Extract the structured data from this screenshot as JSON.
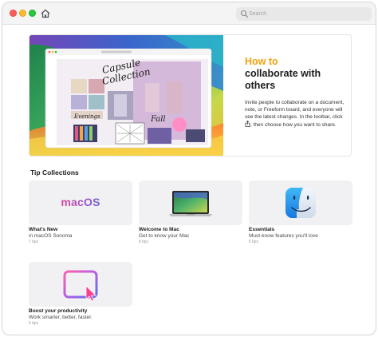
{
  "search": {
    "placeholder": "Search"
  },
  "featured": {
    "kicker": "How to",
    "title": "collaborate with others",
    "body_before_icon": "Invite people to collaborate on a document, note, or Freeform board, and everyone will see the latest changes. In the toolbar, click",
    "body_after_icon": ", then choose how you want to share.",
    "accent_color": "#f2a20f",
    "image_text": {
      "board_line1": "Capsule",
      "board_line2": "Collection",
      "word1": "Evenings",
      "word2": "Fall"
    }
  },
  "collections": {
    "title": "Tip Collections",
    "items": [
      {
        "title": "What's New",
        "subtitle": "in macOS Sonoma",
        "count": "7 tips",
        "thumb_text": "macOS",
        "icon": "macos-wordmark"
      },
      {
        "title": "Welcome to Mac",
        "subtitle": "Get to know your Mac",
        "count": "8 tips",
        "icon": "macbook-icon"
      },
      {
        "title": "Essentials",
        "subtitle": "Must-know features you'll love",
        "count": "6 tips",
        "icon": "finder-icon"
      },
      {
        "title": "Boost your productivity",
        "subtitle": "Work smarter, better, faster.",
        "count": "5 tips",
        "icon": "window-cursor-icon"
      }
    ]
  }
}
